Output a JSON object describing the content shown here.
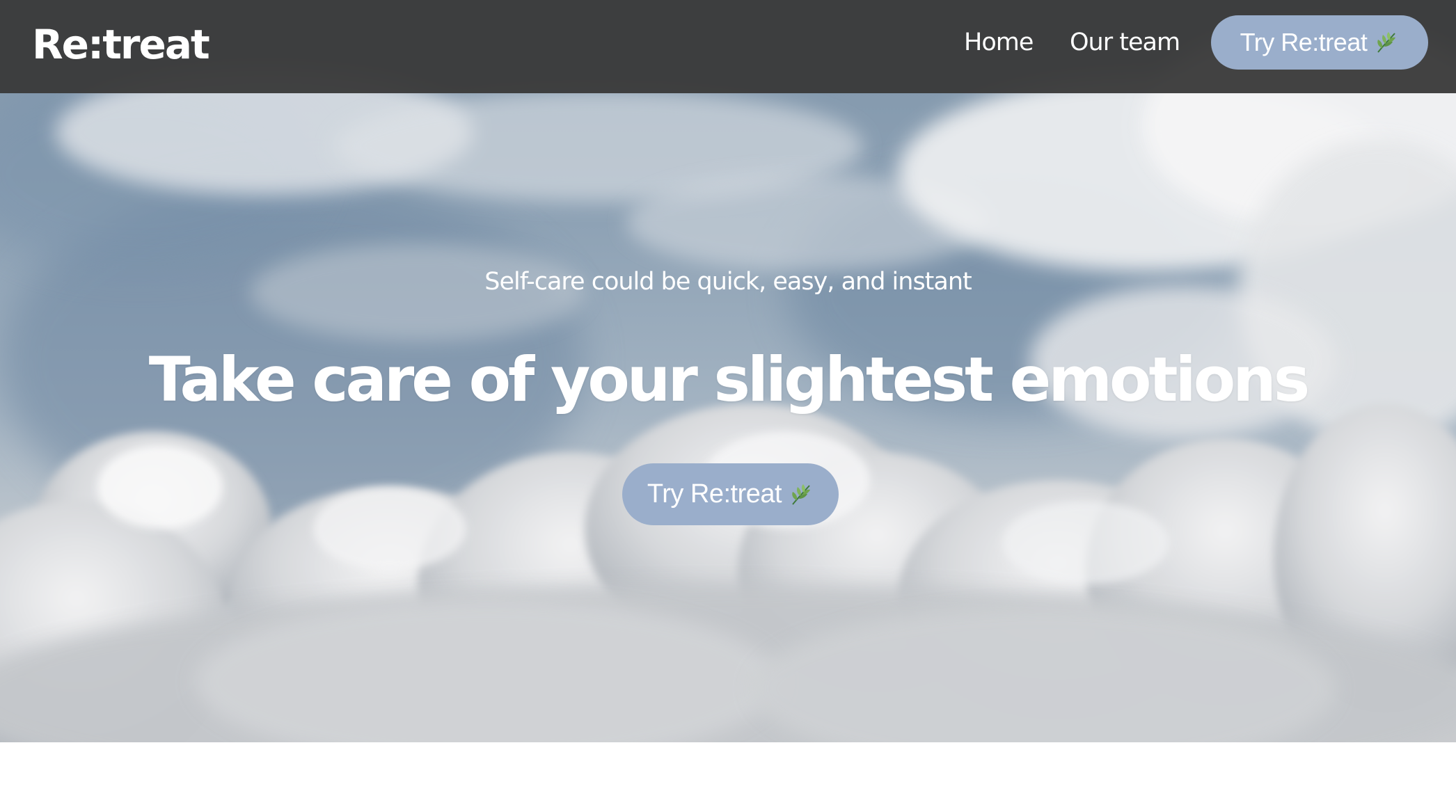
{
  "nav": {
    "brand": "Re:treat",
    "links": [
      "Home",
      "Our team"
    ],
    "cta_label": "Try Re:treat"
  },
  "hero": {
    "tagline": "Self-care could be quick, easy, and instant",
    "headline": "Take care of your slightest emotions",
    "cta_label": "Try Re:treat",
    "background": "sky-with-clouds"
  },
  "icons": {
    "cta_icon": "leaf-icon"
  },
  "colors": {
    "nav_bg": "#3a3a3a",
    "cta_bg": "#9aaecb",
    "text": "#ffffff",
    "page_bg": "#ffffff"
  }
}
